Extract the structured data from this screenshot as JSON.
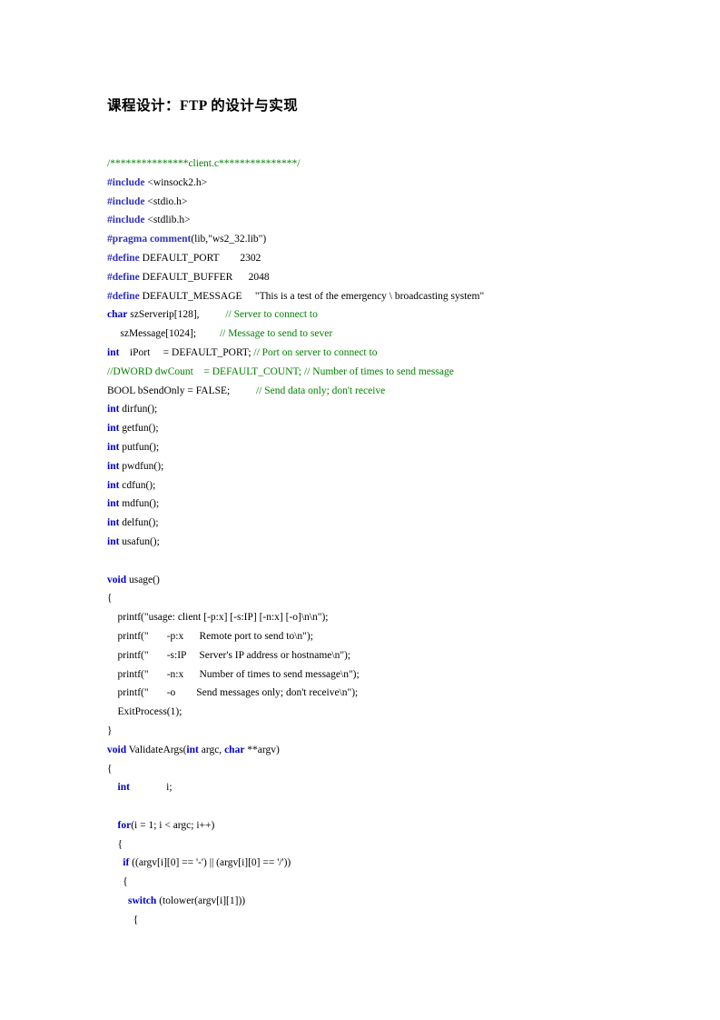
{
  "document": {
    "title": "课程设计：FTP 的设计与实现",
    "page_background": "#ffffff",
    "colors": {
      "keyword": "#0000cc",
      "preprocessor": "#3333bb",
      "comment": "#008000",
      "text": "#000000"
    }
  },
  "code": {
    "language": "c",
    "file_banner": "/***************client.c***************/",
    "lines": [
      {
        "id": 1,
        "indent": 0,
        "tokens": [
          {
            "t": "cm",
            "s": "/***************client.c***************/"
          }
        ]
      },
      {
        "id": 2,
        "indent": 0,
        "tokens": [
          {
            "t": "pp",
            "s": "#include"
          },
          {
            "t": "tx",
            "s": " <winsock2.h>"
          }
        ]
      },
      {
        "id": 3,
        "indent": 0,
        "tokens": [
          {
            "t": "pp",
            "s": "#include"
          },
          {
            "t": "tx",
            "s": " <stdio.h>"
          }
        ]
      },
      {
        "id": 4,
        "indent": 0,
        "tokens": [
          {
            "t": "pp",
            "s": "#include"
          },
          {
            "t": "tx",
            "s": " <stdlib.h>"
          }
        ]
      },
      {
        "id": 5,
        "indent": 0,
        "tokens": [
          {
            "t": "pp",
            "s": "#pragma comment"
          },
          {
            "t": "tx",
            "s": "(lib,\"ws2_32.lib\")"
          }
        ]
      },
      {
        "id": 6,
        "indent": 0,
        "tokens": [
          {
            "t": "pp",
            "s": "#define"
          },
          {
            "t": "tx",
            "s": " DEFAULT_PORT        2302"
          }
        ]
      },
      {
        "id": 7,
        "indent": 0,
        "tokens": [
          {
            "t": "pp",
            "s": "#define"
          },
          {
            "t": "tx",
            "s": " DEFAULT_BUFFER      2048"
          }
        ]
      },
      {
        "id": 8,
        "indent": 0,
        "tokens": [
          {
            "t": "pp",
            "s": "#define"
          },
          {
            "t": "tx",
            "s": " DEFAULT_MESSAGE     \"This is a test of the emergency \\ broadcasting system\""
          }
        ]
      },
      {
        "id": 9,
        "indent": 0,
        "tokens": [
          {
            "t": "kw",
            "s": "char"
          },
          {
            "t": "tx",
            "s": " szServerip[128],          "
          },
          {
            "t": "cm",
            "s": "// Server to connect to"
          }
        ]
      },
      {
        "id": 10,
        "indent": 0,
        "tokens": [
          {
            "t": "tx",
            "s": "     szMessage[1024];         "
          },
          {
            "t": "cm",
            "s": "// Message to send to sever"
          }
        ]
      },
      {
        "id": 11,
        "indent": 0,
        "tokens": [
          {
            "t": "kw",
            "s": "int"
          },
          {
            "t": "tx",
            "s": "    iPort     = DEFAULT_PORT; "
          },
          {
            "t": "cm",
            "s": "// Port on server to connect to"
          }
        ]
      },
      {
        "id": 12,
        "indent": 0,
        "tokens": [
          {
            "t": "cm",
            "s": "//DWORD dwCount    = DEFAULT_COUNT; // Number of times to send message"
          }
        ]
      },
      {
        "id": 13,
        "indent": 0,
        "tokens": [
          {
            "t": "tx",
            "s": "BOOL bSendOnly = FALSE;          "
          },
          {
            "t": "cm",
            "s": "// Send data only; don't receive"
          }
        ]
      },
      {
        "id": 14,
        "indent": 0,
        "tokens": [
          {
            "t": "kw",
            "s": "int"
          },
          {
            "t": "tx",
            "s": " dirfun();"
          }
        ]
      },
      {
        "id": 15,
        "indent": 0,
        "tokens": [
          {
            "t": "kw",
            "s": "int"
          },
          {
            "t": "tx",
            "s": " getfun();"
          }
        ]
      },
      {
        "id": 16,
        "indent": 0,
        "tokens": [
          {
            "t": "kw",
            "s": "int"
          },
          {
            "t": "tx",
            "s": " putfun();"
          }
        ]
      },
      {
        "id": 17,
        "indent": 0,
        "tokens": [
          {
            "t": "kw",
            "s": "int"
          },
          {
            "t": "tx",
            "s": " pwdfun();"
          }
        ]
      },
      {
        "id": 18,
        "indent": 0,
        "tokens": [
          {
            "t": "kw",
            "s": "int"
          },
          {
            "t": "tx",
            "s": " cdfun();"
          }
        ]
      },
      {
        "id": 19,
        "indent": 0,
        "tokens": [
          {
            "t": "kw",
            "s": "int"
          },
          {
            "t": "tx",
            "s": " mdfun();"
          }
        ]
      },
      {
        "id": 20,
        "indent": 0,
        "tokens": [
          {
            "t": "kw",
            "s": "int"
          },
          {
            "t": "tx",
            "s": " delfun();"
          }
        ]
      },
      {
        "id": 21,
        "indent": 0,
        "tokens": [
          {
            "t": "kw",
            "s": "int"
          },
          {
            "t": "tx",
            "s": " usafun();"
          }
        ]
      },
      {
        "id": 22,
        "indent": 0,
        "tokens": [
          {
            "t": "tx",
            "s": " "
          }
        ]
      },
      {
        "id": 23,
        "indent": 0,
        "tokens": [
          {
            "t": "kw",
            "s": "void"
          },
          {
            "t": "tx",
            "s": " usage()"
          }
        ]
      },
      {
        "id": 24,
        "indent": 0,
        "tokens": [
          {
            "t": "tx",
            "s": "{"
          }
        ]
      },
      {
        "id": 25,
        "indent": 0,
        "tokens": [
          {
            "t": "tx",
            "s": "    printf(\"usage: client [-p:x] [-s:IP] [-n:x] [-o]\\n\\n\");"
          }
        ]
      },
      {
        "id": 26,
        "indent": 0,
        "tokens": [
          {
            "t": "tx",
            "s": "    printf(\"       -p:x      Remote port to send to\\n\");"
          }
        ]
      },
      {
        "id": 27,
        "indent": 0,
        "tokens": [
          {
            "t": "tx",
            "s": "    printf(\"       -s:IP     Server's IP address or hostname\\n\");"
          }
        ]
      },
      {
        "id": 28,
        "indent": 0,
        "tokens": [
          {
            "t": "tx",
            "s": "    printf(\"       -n:x      Number of times to send message\\n\");"
          }
        ]
      },
      {
        "id": 29,
        "indent": 0,
        "tokens": [
          {
            "t": "tx",
            "s": "    printf(\"       -o        Send messages only; don't receive\\n\");"
          }
        ]
      },
      {
        "id": 30,
        "indent": 0,
        "tokens": [
          {
            "t": "tx",
            "s": "    ExitProcess(1);"
          }
        ]
      },
      {
        "id": 31,
        "indent": 0,
        "tokens": [
          {
            "t": "tx",
            "s": "}"
          }
        ]
      },
      {
        "id": 32,
        "indent": 0,
        "tokens": [
          {
            "t": "kw",
            "s": "void"
          },
          {
            "t": "tx",
            "s": " ValidateArgs("
          },
          {
            "t": "kw",
            "s": "int"
          },
          {
            "t": "tx",
            "s": " argc, "
          },
          {
            "t": "kw",
            "s": "char"
          },
          {
            "t": "tx",
            "s": " **argv)"
          }
        ]
      },
      {
        "id": 33,
        "indent": 0,
        "tokens": [
          {
            "t": "tx",
            "s": "{"
          }
        ]
      },
      {
        "id": 34,
        "indent": 0,
        "tokens": [
          {
            "t": "tx",
            "s": "    "
          },
          {
            "t": "kw",
            "s": "int"
          },
          {
            "t": "tx",
            "s": "              i;"
          }
        ]
      },
      {
        "id": 35,
        "indent": 0,
        "tokens": [
          {
            "t": "tx",
            "s": " "
          }
        ]
      },
      {
        "id": 36,
        "indent": 0,
        "tokens": [
          {
            "t": "tx",
            "s": "    "
          },
          {
            "t": "kw",
            "s": "for"
          },
          {
            "t": "tx",
            "s": "(i = 1; i < argc; i++)"
          }
        ]
      },
      {
        "id": 37,
        "indent": 0,
        "tokens": [
          {
            "t": "tx",
            "s": "    {"
          }
        ]
      },
      {
        "id": 38,
        "indent": 0,
        "tokens": [
          {
            "t": "tx",
            "s": "      "
          },
          {
            "t": "kw",
            "s": "if"
          },
          {
            "t": "tx",
            "s": " ((argv[i][0] == '-') || (argv[i][0] == '/'))"
          }
        ]
      },
      {
        "id": 39,
        "indent": 0,
        "tokens": [
          {
            "t": "tx",
            "s": "      {"
          }
        ]
      },
      {
        "id": 40,
        "indent": 0,
        "tokens": [
          {
            "t": "tx",
            "s": "        "
          },
          {
            "t": "kw",
            "s": "switch"
          },
          {
            "t": "tx",
            "s": " (tolower(argv[i][1]))"
          }
        ]
      },
      {
        "id": 41,
        "indent": 0,
        "tokens": [
          {
            "t": "tx",
            "s": "          {"
          }
        ]
      }
    ]
  }
}
